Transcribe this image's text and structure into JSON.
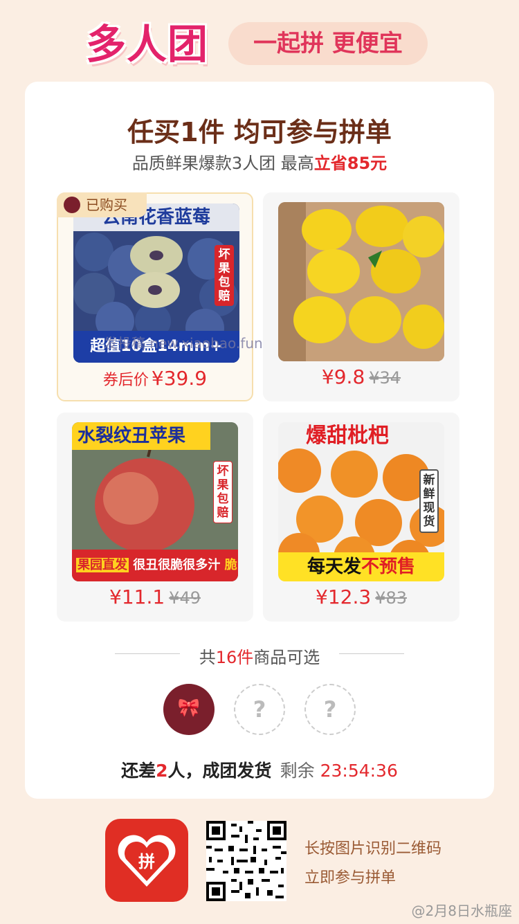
{
  "header": {
    "logo_text": "多人团",
    "slogan": "一起拼 更便宜"
  },
  "card": {
    "title": "任买1件 均可参与拼单",
    "subtitle_prefix": "品质鲜果爆款3人团 最高",
    "subtitle_highlight": "立省85元"
  },
  "products": [
    {
      "badge": "已购买",
      "title": "云南花香蓝莓",
      "side_tag": "坏果包赔",
      "bottom_text": "超值10盒14mm+",
      "price_label": "券后价",
      "price": "¥39.9",
      "orig_price": ""
    },
    {
      "title": "",
      "side_tag": "",
      "bottom_text": "",
      "price_label": "",
      "price": "¥9.8",
      "orig_price": "¥34"
    },
    {
      "title": "水裂纹丑苹果",
      "side_tag": "坏果包赔",
      "bottom_tag": "果园直发",
      "bottom_text": "很丑很脆很多汁",
      "bottom_highlight": "脆甜",
      "price_label": "",
      "price": "¥11.1",
      "orig_price": "¥49"
    },
    {
      "title": "爆甜枇杷",
      "side_tag": "新鲜现货",
      "bottom_text": "每天发",
      "bottom_highlight": "不预售",
      "price_label": "",
      "price": "¥12.3",
      "orig_price": "¥83"
    }
  ],
  "divider": {
    "prefix": "共",
    "count": "16件",
    "suffix": "商品可选"
  },
  "group": {
    "avatar_empty_symbol": "?",
    "status_prefix": "还差",
    "remaining_people": "2",
    "status_suffix": "人，成团发货",
    "remaining_label": "剩余",
    "countdown": "23:54:36"
  },
  "footer": {
    "app_logo_text": "拼",
    "line1": "长按图片识别二维码",
    "line2": "立即参与拼单"
  },
  "watermarks": {
    "middle": "发投稿 new.xiaobao.fun",
    "corner": "@2月8日水瓶座"
  },
  "colors": {
    "accent_red": "#e3282d",
    "brand_pink": "#e3236b",
    "background": "#fbeee3"
  }
}
